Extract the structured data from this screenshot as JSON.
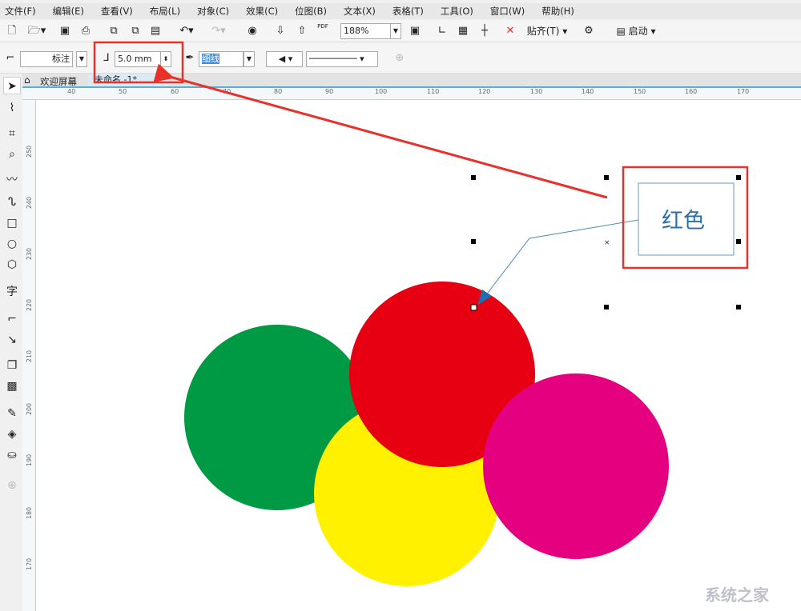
{
  "menu": [
    "文件(F)",
    "编辑(E)",
    "查看(V)",
    "布局(L)",
    "对象(C)",
    "效果(C)",
    "位图(B)",
    "文本(X)",
    "表格(T)",
    "工具(O)",
    "窗口(W)",
    "帮助(H)"
  ],
  "toolbar": {
    "zoom": "188%",
    "snap": "贴齐(T)",
    "launch": "启动",
    "pdf": "PDF"
  },
  "propbar": {
    "callout_style": "标注",
    "gap": "5.0 mm",
    "outline": "细线"
  },
  "tabs": {
    "welcome": "欢迎屏幕",
    "document": "未命名 -1*"
  },
  "hruler": [
    "40",
    "50",
    "60",
    "70",
    "80",
    "90",
    "100",
    "110",
    "120",
    "130",
    "140",
    "150",
    "160",
    "170"
  ],
  "vruler": [
    "250",
    "240",
    "230",
    "220",
    "210",
    "200",
    "190",
    "180",
    "170"
  ],
  "canvas": {
    "callout_text": "红色",
    "circles": [
      {
        "name": "green",
        "color": "#009a44"
      },
      {
        "name": "yellow",
        "color": "#fff100"
      },
      {
        "name": "red",
        "color": "#e60012"
      },
      {
        "name": "magenta",
        "color": "#e4007f"
      }
    ],
    "annotation_color": "#e8312a"
  },
  "watermark": "系统之家"
}
